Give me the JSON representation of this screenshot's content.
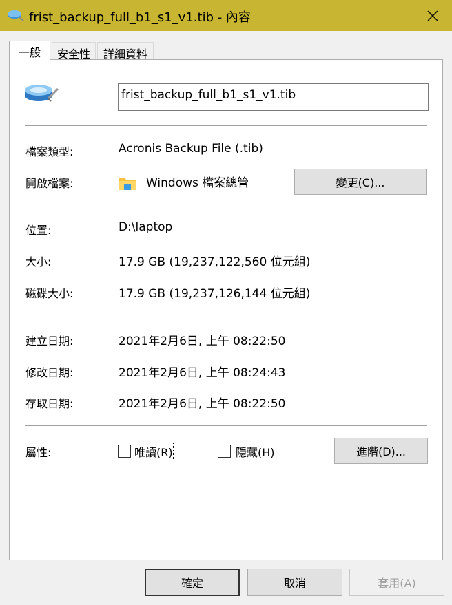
{
  "window": {
    "title": "frist_backup_full_b1_s1_v1.tib - 內容",
    "title_bar_color": "#c8b632",
    "icon": "backup-file-icon"
  },
  "tabs": [
    {
      "label": "一般",
      "active": true
    },
    {
      "label": "安全性",
      "active": false
    },
    {
      "label": "詳細資料",
      "active": false
    }
  ],
  "general": {
    "file_icon": "backup-disk-icon",
    "file_name": "frist_backup_full_b1_s1_v1.tib",
    "file_type_label": "檔案類型:",
    "file_type_value": "Acronis Backup File (.tib)",
    "opens_with_label": "開啟檔案:",
    "opens_with_icon": "folder-icon",
    "opens_with_value": "Windows 檔案總管",
    "change_button": "變更(C)...",
    "location_label": "位置:",
    "location_value": "D:\\laptop",
    "size_label": "大小:",
    "size_value": "17.9 GB (19,237,122,560 位元組)",
    "disk_size_label": "磁碟大小:",
    "disk_size_value": "17.9 GB (19,237,126,144 位元組)",
    "created_label": "建立日期:",
    "created_value": "2021年2月6日, 上午 08:22:50",
    "modified_label": "修改日期:",
    "modified_value": "2021年2月6日, 上午 08:24:43",
    "accessed_label": "存取日期:",
    "accessed_value": "2021年2月6日, 上午 08:22:50",
    "attributes_label": "屬性:",
    "readonly_label": "唯讀(R)",
    "readonly_checked": false,
    "hidden_label": "隱藏(H)",
    "hidden_checked": false,
    "advanced_button": "進階(D)..."
  },
  "footer": {
    "ok": "確定",
    "cancel": "取消",
    "apply": "套用(A)"
  }
}
